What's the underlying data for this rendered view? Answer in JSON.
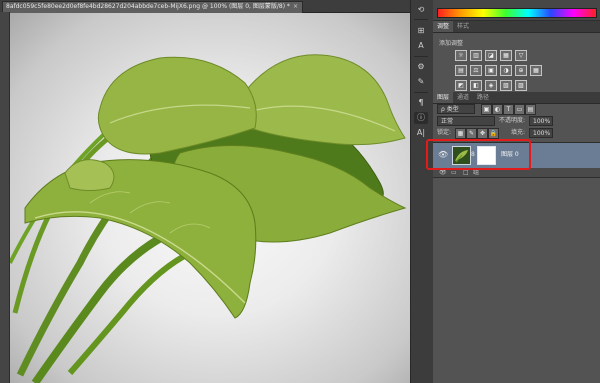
{
  "document": {
    "tab_title": "8afdc059c5fe80ee2d0ef8fe4bd28627d204abbde7ceb-MijX6.png @ 100% (图层 0, 图层蒙版/8) *",
    "close_symbol": "×"
  },
  "gutter": {
    "icons": [
      "rotate-icon",
      "adjust-icon",
      "text-icon",
      "settings-icon",
      "brush-icon",
      "paragraph-icon",
      "info-icon",
      "text-type-icon"
    ],
    "glyphs": [
      "⟲",
      "⊞",
      "A",
      "⚙",
      "✎",
      "¶",
      "ⓘ",
      "A|"
    ]
  },
  "colors": {
    "accent_highlight": "#e31b1b",
    "selected_layer": "#6b7d94"
  },
  "adjustments": {
    "tabs": [
      "调整",
      "样式"
    ],
    "title": "添加调整",
    "icons": [
      [
        "☼",
        "▥",
        "◪",
        "▦",
        "▽"
      ],
      [
        "▤",
        "⚖",
        "▣",
        "◑",
        "⊕",
        "▦"
      ],
      [
        "◩",
        "◧",
        "◈",
        "▧",
        "▨"
      ]
    ]
  },
  "layers": {
    "tabs": [
      "图层",
      "通道",
      "路径"
    ],
    "filter_label": "ρ 类型",
    "filter_icons": [
      "▣",
      "◐",
      "T",
      "▭",
      "▤"
    ],
    "blend_mode": "正常",
    "opacity_label": "不透明度:",
    "opacity_value": "100%",
    "lock_label": "锁定:",
    "lock_icons": [
      "▦",
      "✎",
      "✥",
      "🔒"
    ],
    "fill_label": "填充:",
    "fill_value": "100%",
    "items": [
      {
        "name": "图层 0",
        "eye": "👁",
        "chain": "8",
        "selected": true
      }
    ],
    "group_row": {
      "eye": "👁",
      "folder": "▭",
      "icons": "□",
      "label": "组"
    }
  }
}
